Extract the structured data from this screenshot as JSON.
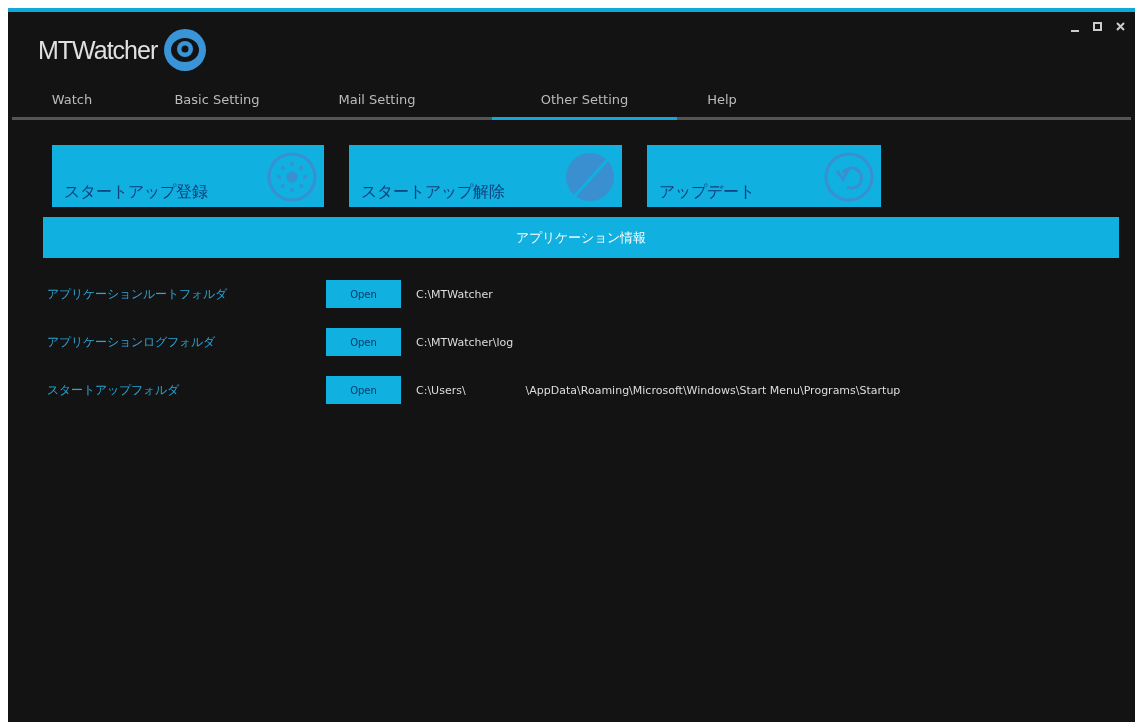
{
  "window": {
    "title": "MTWatcher"
  },
  "tabs": [
    {
      "label": "Watch",
      "selected": false
    },
    {
      "label": "Basic Setting",
      "selected": false
    },
    {
      "label": "Mail Setting",
      "selected": false
    },
    {
      "label": "Other Setting",
      "selected": true
    },
    {
      "label": "Help",
      "selected": false
    }
  ],
  "actions": [
    {
      "label": "スタートアップ登録",
      "kind": "register"
    },
    {
      "label": "スタートアップ解除",
      "kind": "unregister"
    },
    {
      "label": "アップデート",
      "kind": "update"
    }
  ],
  "section": {
    "title": "アプリケーション情報"
  },
  "folders": [
    {
      "label": "アプリケーションルートフォルダ",
      "button": "Open",
      "path": [
        "C:\\MTWatcher"
      ]
    },
    {
      "label": "アプリケーションログフォルダ",
      "button": "Open",
      "path": [
        "C:\\MTWatcher\\log"
      ]
    },
    {
      "label": "スタートアップフォルダ",
      "button": "Open",
      "path": [
        "C:\\Users\\",
        "\\AppData\\Roaming\\Microsoft\\Windows\\Start Menu\\Programs\\Startup"
      ]
    }
  ]
}
